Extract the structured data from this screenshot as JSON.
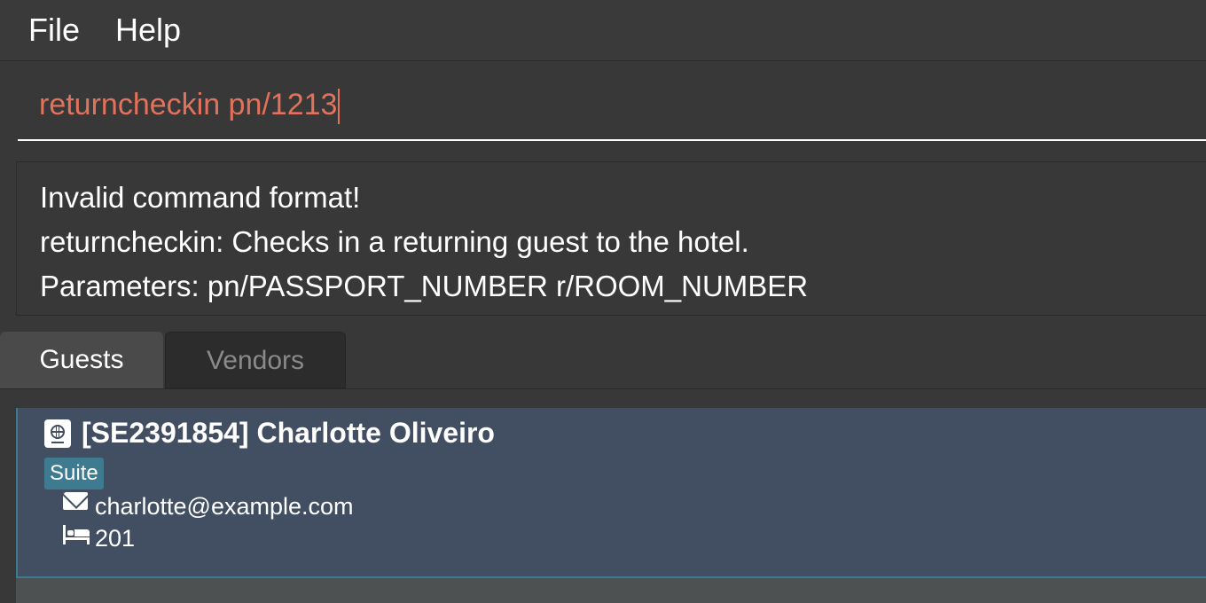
{
  "menu": {
    "file": "File",
    "help": "Help"
  },
  "command": {
    "value": "returncheckin pn/1213"
  },
  "result": {
    "line1": "Invalid command format!",
    "line2": "returncheckin: Checks in a returning guest to the hotel.",
    "line3": "Parameters: pn/PASSPORT_NUMBER r/ROOM_NUMBER"
  },
  "tabs": [
    {
      "label": "Guests",
      "active": true
    },
    {
      "label": "Vendors",
      "active": false
    }
  ],
  "guests": [
    {
      "title": "[SE2391854] Charlotte Oliveiro",
      "tag": "Suite",
      "email": "charlotte@example.com",
      "room": "201",
      "icons": [
        "passport-icon",
        "email-icon",
        "bed-icon"
      ]
    }
  ],
  "colors": {
    "background": "#383838",
    "command_text": "#e2725b",
    "card_background": "#424f63",
    "tag_background": "#3e7b91"
  }
}
